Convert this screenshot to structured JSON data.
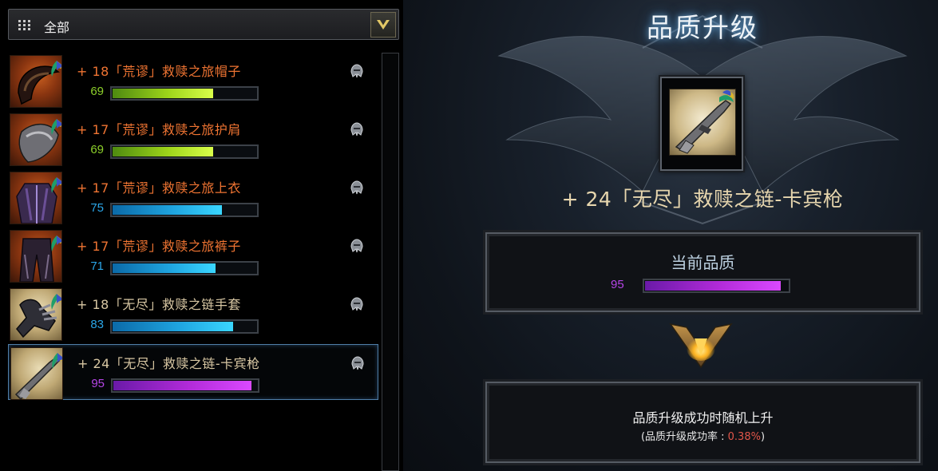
{
  "filter": {
    "label": "全部"
  },
  "items": [
    {
      "name": "+ 18「荒谬」救赎之旅帽子",
      "quality": 69,
      "name_color": "orange",
      "bar_color": "green",
      "thumb": "helmet"
    },
    {
      "name": "+ 17「荒谬」救赎之旅护肩",
      "quality": 69,
      "name_color": "orange",
      "bar_color": "green",
      "thumb": "shoulder"
    },
    {
      "name": "+ 17「荒谬」救赎之旅上衣",
      "quality": 75,
      "name_color": "orange",
      "bar_color": "blue",
      "thumb": "armor"
    },
    {
      "name": "+ 17「荒谬」救赎之旅裤子",
      "quality": 71,
      "name_color": "orange",
      "bar_color": "blue",
      "thumb": "pants"
    },
    {
      "name": "+ 18「无尽」救赎之链手套",
      "quality": 83,
      "name_color": "beige",
      "bar_color": "blue",
      "thumb": "gloves"
    },
    {
      "name": "+ 24「无尽」救赎之链-卡宾枪",
      "quality": 95,
      "name_color": "beige",
      "bar_color": "purple",
      "thumb": "rifle",
      "selected": true
    }
  ],
  "upgrade": {
    "title": "品质升级",
    "item_name": "+ 24「无尽」救赎之链-卡宾枪",
    "current_label": "当前品质",
    "current_value": 95,
    "info_line1": "品质升级成功时随机上升",
    "info_prefix": "(品质升级成功率 : ",
    "success_rate": "0.38%",
    "info_suffix": ")"
  },
  "colors": {
    "quality_green": "#8ccf2a",
    "quality_blue": "#2aa6e8",
    "quality_purple": "#b545e6",
    "name_orange": "#ef7432",
    "name_beige": "#d8c7a3",
    "rate_red": "#e2564a"
  },
  "icons": {
    "filter": "grid-icon",
    "dropdown": "chevron-down-icon",
    "item_action": "helmet-icon",
    "divider": "down-arrow-icon"
  }
}
